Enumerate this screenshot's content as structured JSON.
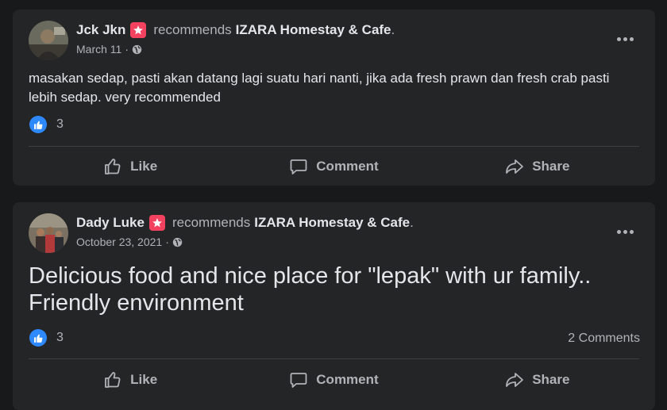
{
  "colors": {
    "background": "#18191a",
    "card": "#242526",
    "primary_text": "#e4e6eb",
    "secondary_text": "#b0b3b8",
    "like_blue": "#2e89ff",
    "recommend_badge": "#f3425f"
  },
  "icons": {
    "recommend_badge": "star-badge-icon",
    "privacy": "globe-icon",
    "more": "more-options-icon",
    "reaction": "thumbs-up-icon",
    "like": "thumbs-up-outline-icon",
    "comment": "speech-bubble-icon",
    "share": "share-arrow-icon"
  },
  "posts": [
    {
      "author": "Jck Jkn",
      "recommends_text": "recommends",
      "page": "IZARA Homestay & Cafe",
      "period": ".",
      "date": "March 11",
      "separator": "·",
      "body": "masakan sedap, pasti akan datang lagi suatu hari nanti, jika ada fresh prawn dan fresh crab pasti lebih sedap. very recommended",
      "reactions": "3",
      "comments": "",
      "actions": {
        "like": "Like",
        "comment": "Comment",
        "share": "Share"
      }
    },
    {
      "author": "Dady Luke",
      "recommends_text": "recommends",
      "page": "IZARA Homestay & Cafe",
      "period": ".",
      "date": "October 23, 2021",
      "separator": "·",
      "body": "Delicious food and nice place for \"lepak\" with ur family.. Friendly environment",
      "reactions": "3",
      "comments": "2 Comments",
      "actions": {
        "like": "Like",
        "comment": "Comment",
        "share": "Share"
      }
    }
  ]
}
